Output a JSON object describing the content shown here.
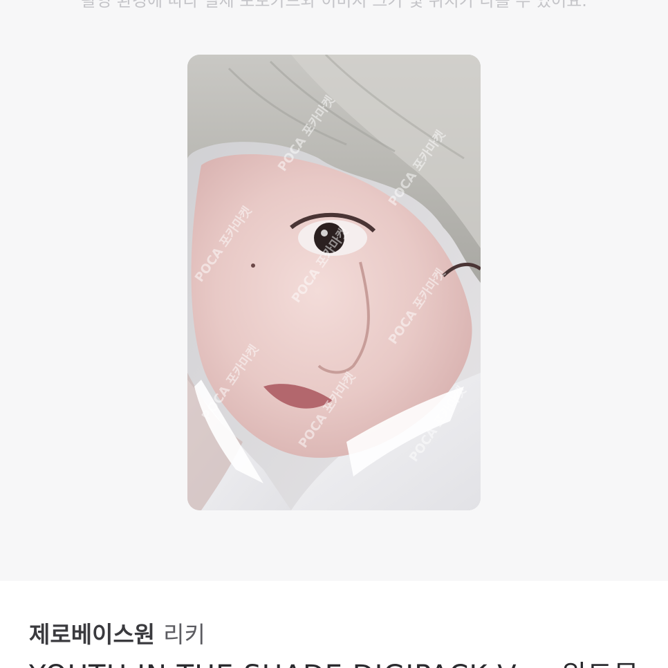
{
  "notice": {
    "text": "촬영 환경에 따라 실제 포토카드와 이미지 크기 및 위치가 다를 수 있어요."
  },
  "photocard": {
    "watermark": "POCA 포카마켓"
  },
  "product": {
    "artist": "제로베이스원",
    "member": "리키",
    "name": "YOUTH IN THE SHADE DIGIPACK Ver. 위드뮤"
  }
}
